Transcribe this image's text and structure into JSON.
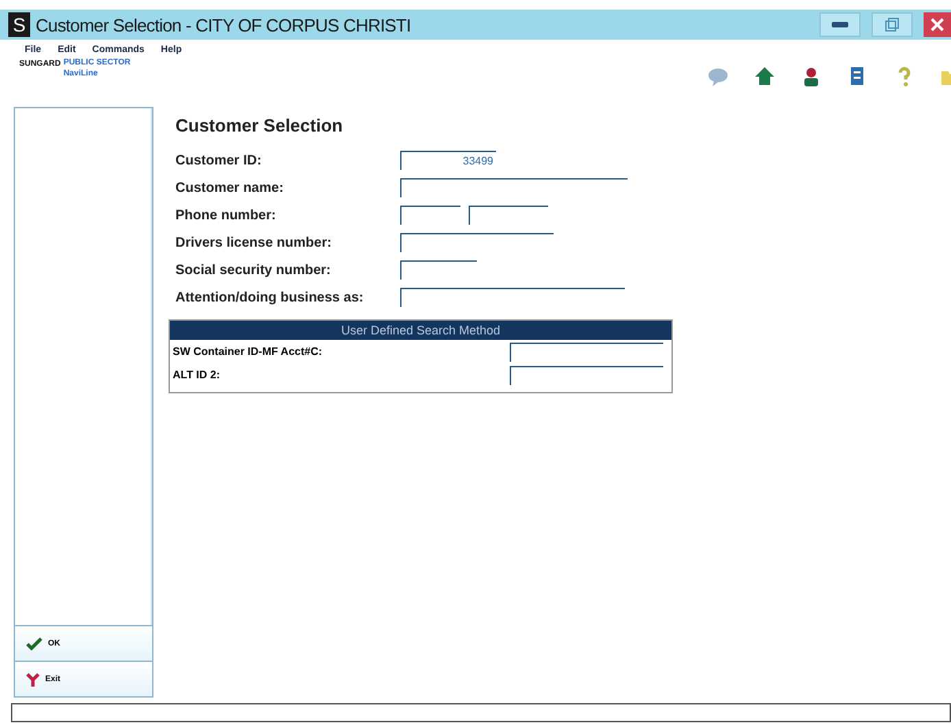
{
  "window": {
    "app_letter": "S",
    "title": "Customer Selection - CITY OF CORPUS CHRISTI"
  },
  "menu": [
    "File",
    "Edit",
    "Commands",
    "Help"
  ],
  "logo": {
    "brand": "SUNGARD",
    "line1": "PUBLIC SECTOR",
    "line2": "NaviLine"
  },
  "sidebar": {
    "buttons": [
      {
        "kind": "ok",
        "label": "OK"
      },
      {
        "kind": "exit",
        "label": "Exit"
      }
    ]
  },
  "form": {
    "heading": "Customer Selection",
    "fields": [
      {
        "label": "Customer ID:",
        "value": "33499"
      },
      {
        "label": "Customer name:"
      },
      {
        "label": "Phone number:"
      },
      {
        "label": "Drivers license number:"
      },
      {
        "label": "Social security number:"
      },
      {
        "label": "Attention/doing business as:"
      }
    ],
    "search_section": {
      "title": "User Defined Search Method",
      "fields": [
        {
          "label": "SW Container ID-MF Acct#C:"
        },
        {
          "label": "ALT ID 2:"
        }
      ]
    }
  }
}
